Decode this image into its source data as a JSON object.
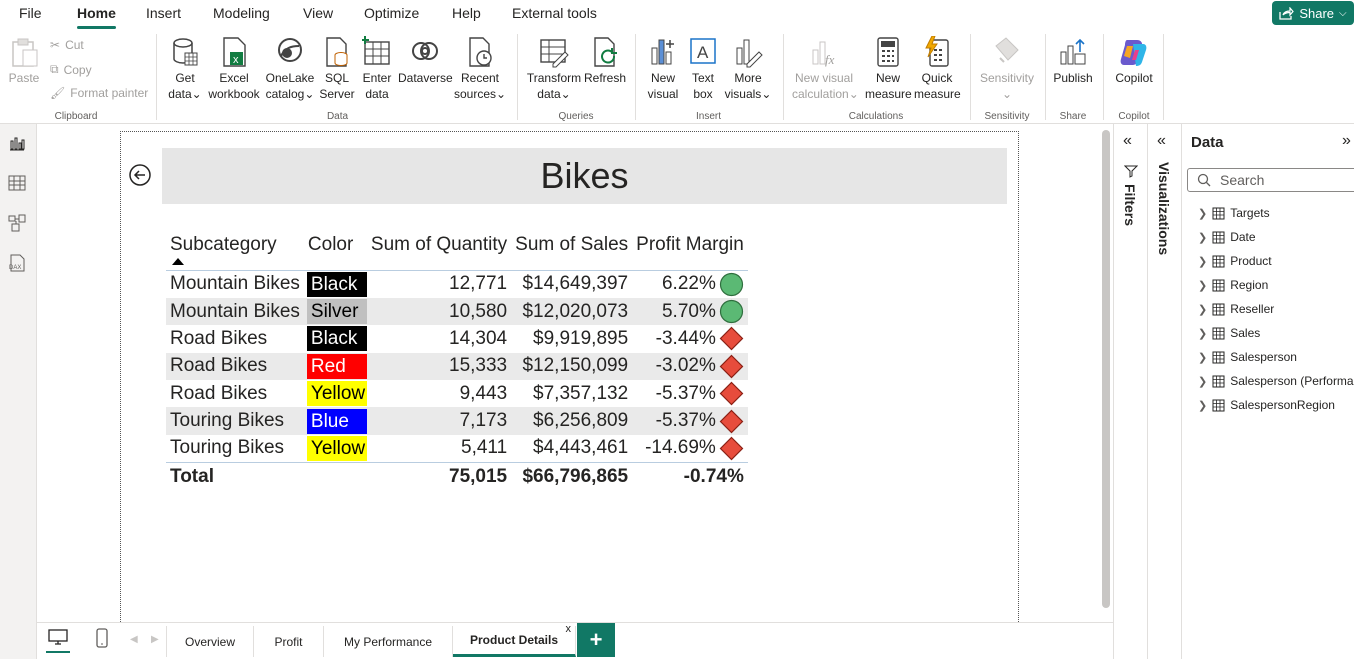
{
  "menu": {
    "file": "File",
    "home": "Home",
    "insert": "Insert",
    "modeling": "Modeling",
    "view": "View",
    "optimize": "Optimize",
    "help": "Help",
    "external_tools": "External tools",
    "share": "Share"
  },
  "ribbon": {
    "paste": "Paste",
    "cut": "Cut",
    "copy": "Copy",
    "format_painter": "Format painter",
    "clipboard": "Clipboard",
    "get_data": [
      "Get",
      "data"
    ],
    "excel": [
      "Excel",
      "workbook"
    ],
    "onelake": [
      "OneLake",
      "catalog"
    ],
    "sql": [
      "SQL",
      "Server"
    ],
    "enter": [
      "Enter",
      "data"
    ],
    "dataverse": "Dataverse",
    "recent": [
      "Recent",
      "sources"
    ],
    "data_group": "Data",
    "transform": [
      "Transform",
      "data"
    ],
    "refresh": "Refresh",
    "queries": "Queries",
    "new_visual": [
      "New",
      "visual"
    ],
    "text_box": [
      "Text",
      "box"
    ],
    "more_visuals": [
      "More",
      "visuals"
    ],
    "insert_group": "Insert",
    "new_visual_calc": [
      "New visual",
      "calculation"
    ],
    "new_measure": [
      "New",
      "measure"
    ],
    "quick_measure": [
      "Quick",
      "measure"
    ],
    "calculations": "Calculations",
    "sensitivity": "Sensitivity",
    "sensitivity_group": "Sensitivity",
    "publish": "Publish",
    "share_group": "Share",
    "copilot": "Copilot",
    "copilot_group": "Copilot"
  },
  "report": {
    "title": "Bikes",
    "columns": [
      "Subcategory",
      "Color",
      "Sum of Quantity",
      "Sum of Sales",
      "Profit Margin"
    ],
    "rows": [
      {
        "subcategory": "Mountain Bikes",
        "color": "Black",
        "color_bg": "#000000",
        "color_fg": "#ffffff",
        "quantity": "12,771",
        "sales": "$14,649,397",
        "margin": "6.22%",
        "indicator": "green-circle"
      },
      {
        "subcategory": "Mountain Bikes",
        "color": "Silver",
        "color_bg": "#c0c0c0",
        "color_fg": "#000000",
        "quantity": "10,580",
        "sales": "$12,020,073",
        "margin": "5.70%",
        "indicator": "green-circle"
      },
      {
        "subcategory": "Road Bikes",
        "color": "Black",
        "color_bg": "#000000",
        "color_fg": "#ffffff",
        "quantity": "14,304",
        "sales": "$9,919,895",
        "margin": "-3.44%",
        "indicator": "red-diamond"
      },
      {
        "subcategory": "Road Bikes",
        "color": "Red",
        "color_bg": "#ff0000",
        "color_fg": "#ffffff",
        "quantity": "15,333",
        "sales": "$12,150,099",
        "margin": "-3.02%",
        "indicator": "red-diamond"
      },
      {
        "subcategory": "Road Bikes",
        "color": "Yellow",
        "color_bg": "#ffff00",
        "color_fg": "#000000",
        "quantity": "9,443",
        "sales": "$7,357,132",
        "margin": "-5.37%",
        "indicator": "red-diamond"
      },
      {
        "subcategory": "Touring Bikes",
        "color": "Blue",
        "color_bg": "#0000ff",
        "color_fg": "#ffffff",
        "quantity": "7,173",
        "sales": "$6,256,809",
        "margin": "-5.37%",
        "indicator": "red-diamond"
      },
      {
        "subcategory": "Touring Bikes",
        "color": "Yellow",
        "color_bg": "#ffff00",
        "color_fg": "#000000",
        "quantity": "5,411",
        "sales": "$4,443,461",
        "margin": "-14.69%",
        "indicator": "red-diamond"
      }
    ],
    "total": {
      "label": "Total",
      "quantity": "75,015",
      "sales": "$66,796,865",
      "margin": "-0.74%"
    }
  },
  "panes": {
    "filters": "Filters",
    "visualizations": "Visualizations",
    "data": "Data",
    "search_placeholder": "Search",
    "tables": [
      "Targets",
      "Date",
      "Product",
      "Region",
      "Reseller",
      "Sales",
      "Salesperson",
      "Salesperson (Performa...",
      "SalespersonRegion"
    ]
  },
  "tabs": [
    "Overview",
    "Profit",
    "My Performance",
    "Product Details"
  ],
  "tab_close": "x",
  "add_tab": "+",
  "colors": {
    "accent": "#117865",
    "good": "#5bb974",
    "bad": "#e74c3c"
  }
}
